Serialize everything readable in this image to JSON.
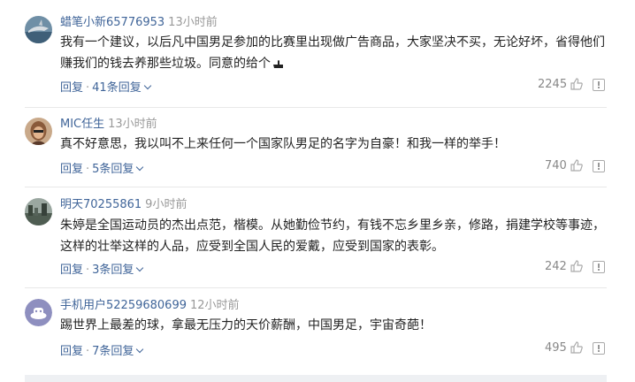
{
  "comments": [
    {
      "username": "蜡笔小新65776953",
      "time": "13小时前",
      "text": "我有一个建议，以后凡中国男足参加的比赛里出现做广告商品，大家坚决不买，无论好坏，省得他们赚我们的钱去养那些垃圾。同意的给个",
      "reply_label": "回复",
      "replies_label": "41条回复",
      "likes": "2245",
      "avatar": "shark-avatar"
    },
    {
      "username": "MIC任生",
      "time": "13小时前",
      "text": "真不好意思，我以叫不上来任何一个国家队男足的名字为自豪！和我一样的举手！",
      "reply_label": "回复",
      "replies_label": "5条回复",
      "likes": "740",
      "avatar": "person-avatar"
    },
    {
      "username": "明天70255861",
      "time": "9小时前",
      "text": "朱婷是全国运动员的杰出点范，楷模。从她勤俭节约，有钱不忘乡里乡亲，修路，捐建学校等事迹，这样的壮举这样的人品，应受到全国人民的爱戴，应受到国家的表彰。",
      "reply_label": "回复",
      "replies_label": "3条回复",
      "likes": "242",
      "avatar": "landscape-avatar"
    },
    {
      "username": "手机用户52259680699",
      "time": "12小时前",
      "text": "踢世界上最差的球，拿最无压力的天价薪酬，中国男足，宇宙奇葩！",
      "reply_label": "回复",
      "replies_label": "7条回复",
      "likes": "495",
      "avatar": "default-avatar"
    }
  ],
  "colors": {
    "link": "#406599",
    "muted": "#999999",
    "divider": "#e8e8e8"
  }
}
